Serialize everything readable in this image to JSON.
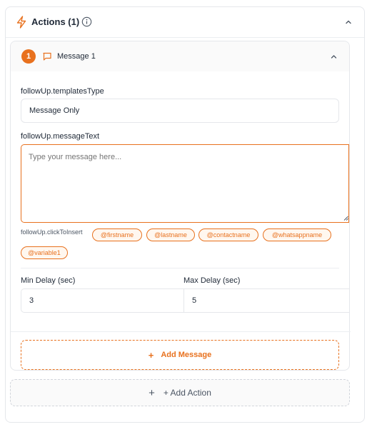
{
  "colors": {
    "accent": "#e8711e",
    "border": "#e5e7eb",
    "text": "#1f2937"
  },
  "actions_panel": {
    "title": "Actions (1)",
    "icons": {
      "leading": "lightning-bolt-icon",
      "info": "info-icon",
      "collapse": "chevron-up-icon"
    }
  },
  "message_card": {
    "number": "1",
    "title": "Message 1",
    "icons": {
      "message": "chat-bubble-icon",
      "collapse": "chevron-up-icon"
    },
    "template_type": {
      "label": "followUp.templatesType",
      "value": "Message Only"
    },
    "message_text": {
      "label": "followUp.messageText",
      "placeholder": "Type your message here..."
    },
    "click_to_insert": {
      "label": "followUp.clickToInsert",
      "variables": [
        "@firstname",
        "@lastname",
        "@contactname",
        "@whatsappname",
        "@variable1"
      ]
    },
    "min_delay": {
      "label": "Min Delay (sec)",
      "value": "3"
    },
    "max_delay": {
      "label": "Max Delay (sec)",
      "value": "5"
    },
    "add_message_label": "Add Message"
  },
  "add_action_label": "+ Add Action"
}
